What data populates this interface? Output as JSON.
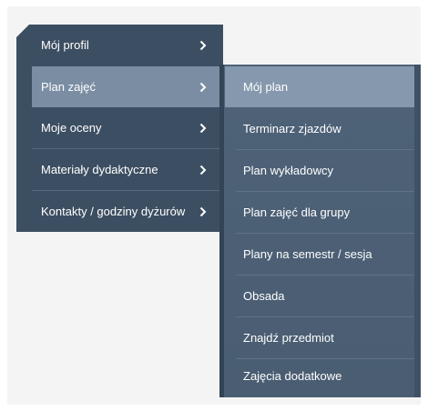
{
  "main_menu": {
    "items": [
      {
        "label": "Mój profil"
      },
      {
        "label": "Plan zajęć"
      },
      {
        "label": "Moje oceny"
      },
      {
        "label": "Materiały dydaktyczne"
      },
      {
        "label": "Kontakty / godziny dyżurów"
      }
    ],
    "active_item": "Plan zajęć"
  },
  "sub_menu": {
    "items": [
      {
        "label": "Mój plan"
      },
      {
        "label": "Terminarz zjazdów"
      },
      {
        "label": "Plan wykładowcy"
      },
      {
        "label": "Plan zajęć dla grupy"
      },
      {
        "label": "Plany na semestr / sesja"
      },
      {
        "label": "Obsada"
      },
      {
        "label": "Znajdź przedmiot"
      },
      {
        "label": "Zajęcia dodatkowe"
      }
    ],
    "active_item": "Mój plan"
  },
  "icons": {
    "submenu_indicator": "chevron-right-icon"
  },
  "colors": {
    "menu_bg": "#3c4e61",
    "active_bg": "#7a8da3",
    "submenu_bg": "#4e6278",
    "submenu_active_bg": "#8598ad",
    "text": "#ffffff"
  }
}
